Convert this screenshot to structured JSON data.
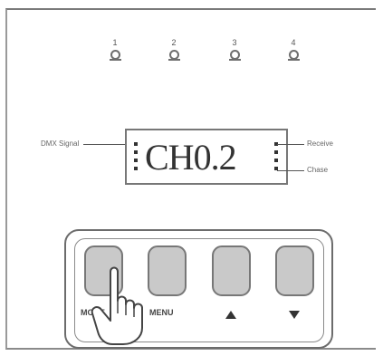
{
  "leds": [
    {
      "label": "1"
    },
    {
      "label": "2"
    },
    {
      "label": "3"
    },
    {
      "label": "4"
    }
  ],
  "display": {
    "text": "CH0.2",
    "left_label": "DMX Signal",
    "right_top_label": "Receive",
    "right_bottom_label": "Chase"
  },
  "keys": [
    {
      "label": "MODE",
      "icon": "none"
    },
    {
      "label": "MENU",
      "icon": "none"
    },
    {
      "label": "",
      "icon": "up-arrow"
    },
    {
      "label": "",
      "icon": "down-arrow"
    }
  ]
}
